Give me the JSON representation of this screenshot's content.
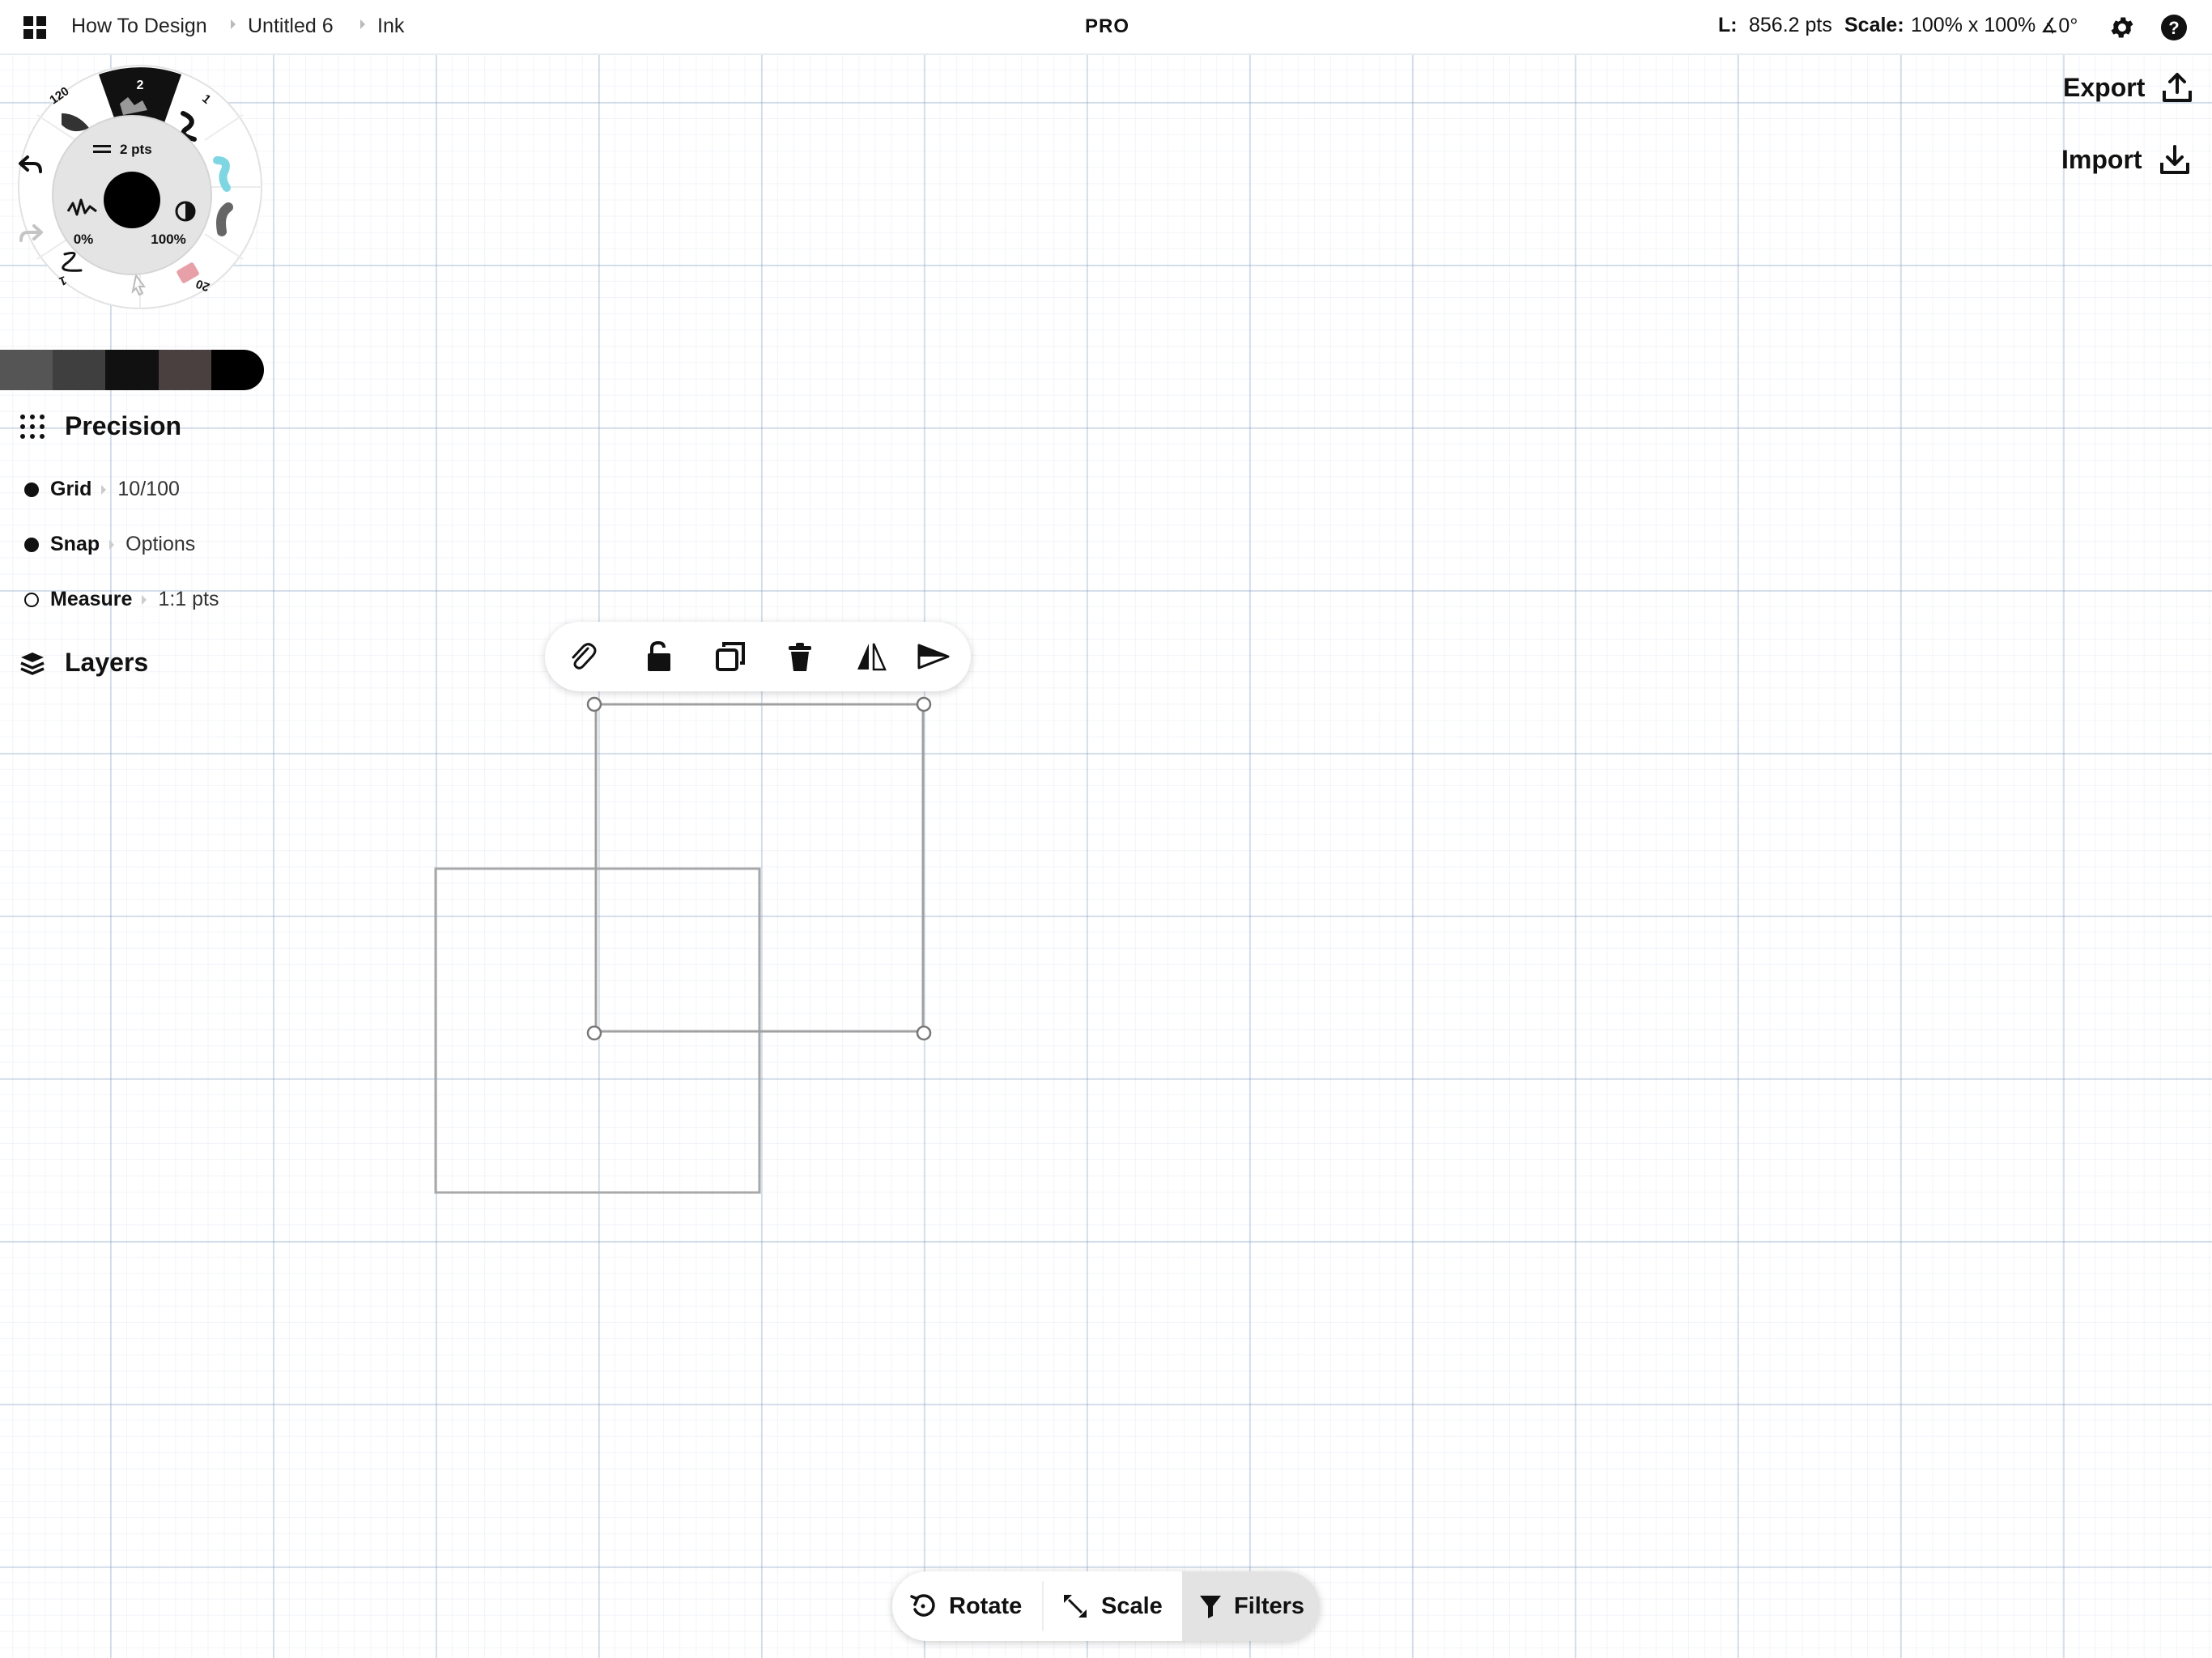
{
  "topbar": {
    "breadcrumbs": [
      "How To Design",
      "Untitled 6",
      "Ink"
    ],
    "badge": "PRO",
    "length_label": "L:",
    "length_value": "856.2 pts",
    "scale_label": "Scale:",
    "scale_value": "100% x 100%",
    "angle_value": "∡0°"
  },
  "actions": {
    "export_label": "Export",
    "import_label": "Import"
  },
  "brush_wheel": {
    "size": "2 pts",
    "opacity_min": "0%",
    "opacity_max": "100%",
    "slots": [
      "2",
      "1",
      "20",
      "1",
      "120"
    ]
  },
  "palette": [
    "#555555",
    "#3f3f3f",
    "#111111",
    "#4a4040",
    "#000000"
  ],
  "precision": {
    "title": "Precision",
    "grid": {
      "label": "Grid",
      "value": "10/100",
      "enabled": true
    },
    "snap": {
      "label": "Snap",
      "value": "Options",
      "enabled": true
    },
    "measure": {
      "label": "Measure",
      "value": "1:1 pts",
      "enabled": false
    }
  },
  "layers": {
    "title": "Layers"
  },
  "selection_toolbar": [
    "paperclip-icon",
    "lock-open-icon",
    "duplicate-icon",
    "trash-icon",
    "mirror-icon",
    "send-icon"
  ],
  "bottombar": {
    "rotate_label": "Rotate",
    "scale_label": "Scale",
    "filters_label": "Filters"
  },
  "colors": {
    "ink": "#111111",
    "grid": "#dfe6f0",
    "selection": "#999999"
  }
}
